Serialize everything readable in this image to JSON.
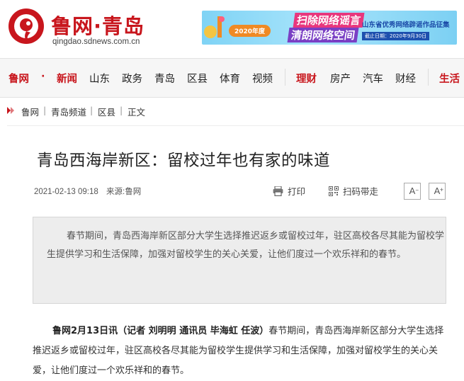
{
  "header": {
    "logo_text": "鲁网·青岛",
    "logo_domain": "qingdao.sdnews.com.cn",
    "banner": {
      "year_badge": "2020年度",
      "slogan_1": "扫除网络谣言",
      "slogan_2": "清朗网络空间",
      "right_title": "山东省优秀网络辟谣作品征集",
      "right_note": "截止日期：2020年9月30日"
    }
  },
  "nav": {
    "items": [
      {
        "label": "鲁网"
      },
      {
        "label": "·"
      },
      {
        "label": "新闻"
      },
      {
        "label": "山东"
      },
      {
        "label": "政务"
      },
      {
        "label": "青岛"
      },
      {
        "label": "区县"
      },
      {
        "label": "体育"
      },
      {
        "label": "视频"
      },
      {
        "label": "理财"
      },
      {
        "label": "房产"
      },
      {
        "label": "汽车"
      },
      {
        "label": "财经"
      },
      {
        "label": "生活"
      }
    ]
  },
  "breadcrumb": {
    "items": [
      "鲁网",
      "青岛频道",
      "区县",
      "正文"
    ],
    "separator": "|"
  },
  "article": {
    "title": "青岛西海岸新区：留校过年也有家的味道",
    "date": "2021-02-13 09:18",
    "source": "来源:鲁网",
    "print_label": "打印",
    "qr_label": "扫码带走",
    "font_smaller": "A",
    "font_larger": "A",
    "summary": "春节期间，青岛西海岸新区部分大学生选择推迟返乡或留校过年，驻区高校各尽其能为留校学生提供学习和生活保障，加强对留校学生的关心关爱，让他们度过一个欢乐祥和的春节。",
    "lead_bold": "鲁网2月13日讯（记者 刘明明 通讯员 毕海虹 任波）",
    "lead_text": "春节期间，青岛西海岸新区部分大学生选择推迟返乡或留校过年，驻区高校各尽其能为留校学生提供学习和生活保障，加强对留校学生的关心关爱，让他们度过一个欢乐祥和的春节。"
  },
  "colors": {
    "brand_red": "#c8161d",
    "nav_bg": "#f6f6f6",
    "summary_bg": "#ededed"
  }
}
